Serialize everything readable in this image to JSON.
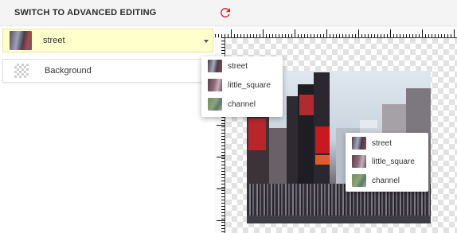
{
  "header": {
    "title": "SWITCH TO ADVANCED EDITING",
    "reset_icon": "refresh-icon",
    "accent_color": "#d32f2f"
  },
  "layers": [
    {
      "label": "street",
      "selected": true,
      "icon": "street-thumbnail"
    },
    {
      "label": "Background",
      "selected": false,
      "icon": "checkerboard-thumbnail"
    }
  ],
  "layer_dropdown": {
    "options": [
      "street",
      "little_square",
      "channel"
    ]
  },
  "canvas_menu": {
    "options": [
      "street",
      "little_square",
      "channel"
    ]
  },
  "colors": {
    "selected_row": "#ffffcc",
    "topbar": "#f4f4f4"
  }
}
